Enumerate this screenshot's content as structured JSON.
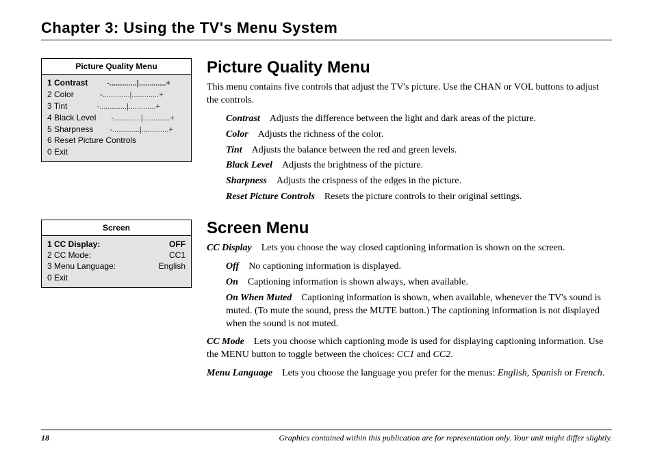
{
  "chapter_title": "Chapter 3: Using the TV's Menu System",
  "osd_picture": {
    "title": "Picture Quality Menu",
    "items": [
      {
        "label": "1 Contrast",
        "type": "slider",
        "selected": true
      },
      {
        "label": "2 Color",
        "type": "slider",
        "selected": false
      },
      {
        "label": "3 Tint",
        "type": "slider",
        "selected": false
      },
      {
        "label": "4 Black Level",
        "type": "slider",
        "selected": false
      },
      {
        "label": "5 Sharpness",
        "type": "slider",
        "selected": false
      },
      {
        "label": "6 Reset Picture Controls",
        "type": "text",
        "selected": false
      },
      {
        "label": "0 Exit",
        "type": "text",
        "selected": false
      }
    ]
  },
  "osd_screen": {
    "title": "Screen",
    "items": [
      {
        "label": "1 CC Display:",
        "value": "OFF",
        "selected": true
      },
      {
        "label": "2 CC Mode:",
        "value": "CC1",
        "selected": false
      },
      {
        "label": "3 Menu Language:",
        "value": "English",
        "selected": false
      },
      {
        "label": "0 Exit",
        "value": "",
        "selected": false
      }
    ]
  },
  "sec_pq": {
    "heading": "Picture Quality Menu",
    "intro": "This menu contains five controls that adjust the TV's picture. Use the CHAN or VOL buttons to adjust the controls.",
    "defs": [
      {
        "term": "Contrast",
        "text": "Adjusts the difference between the light and dark areas of the picture."
      },
      {
        "term": "Color",
        "text": "Adjusts the richness of the color."
      },
      {
        "term": "Tint",
        "text": "Adjusts the balance between the red and green levels."
      },
      {
        "term": "Black Level",
        "text": "Adjusts the brightness of the picture."
      },
      {
        "term": "Sharpness",
        "text": "Adjusts the crispness of the edges in the picture."
      },
      {
        "term": "Reset Picture Controls",
        "text": "Resets the picture controls to their original settings."
      }
    ]
  },
  "sec_screen": {
    "heading": "Screen Menu",
    "ccdisplay_term": "CC Display",
    "ccdisplay_text": "Lets you choose the way closed captioning information is shown on the screen.",
    "options": [
      {
        "term": "Off",
        "text": "No captioning information is displayed."
      },
      {
        "term": "On",
        "text": "Captioning information is shown always, when available."
      },
      {
        "term": "On When Muted",
        "text": "Captioning information is shown, when available, whenever the TV's sound is muted. (To mute the sound, press the MUTE button.) The captioning information is not displayed when the sound is not muted."
      }
    ],
    "ccmode_term": "CC Mode",
    "ccmode_text_a": "Lets you choose which captioning mode is used for displaying captioning information. Use the MENU button to toggle between the choices: ",
    "ccmode_i1": "CC1",
    "ccmode_and": " and ",
    "ccmode_i2": "CC2",
    "ccmode_end": ".",
    "menulang_term": "Menu Language",
    "menulang_text_a": "Lets you choose the language you prefer for the menus: ",
    "menulang_i1": "English",
    "menulang_c1": ", ",
    "menulang_i2": "Spanish",
    "menulang_or": " or ",
    "menulang_i3": "French",
    "menulang_end": "."
  },
  "footer": {
    "page": "18",
    "note": "Graphics contained within this publication are for representation only. Your unit might differ slightly."
  }
}
